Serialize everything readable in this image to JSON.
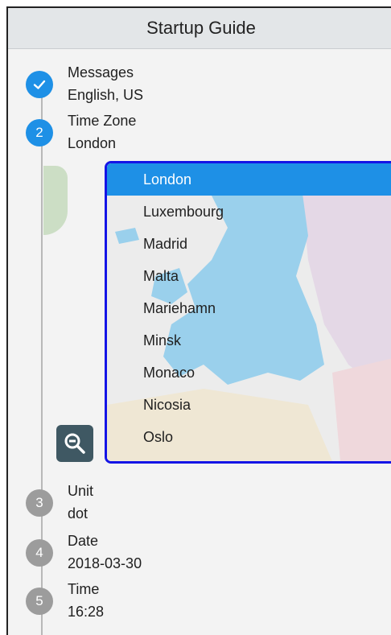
{
  "header": {
    "title": "Startup Guide"
  },
  "steps": [
    {
      "number": "✓",
      "title": "Messages",
      "value": "English, US",
      "state": "done"
    },
    {
      "number": "2",
      "title": "Time Zone",
      "value": "London",
      "state": "active"
    },
    {
      "number": "3",
      "title": "Unit",
      "value": "dot",
      "state": "inactive"
    },
    {
      "number": "4",
      "title": "Date",
      "value": "2018-03-30",
      "state": "inactive"
    },
    {
      "number": "5",
      "title": "Time",
      "value": "16:28",
      "state": "inactive"
    }
  ],
  "timezone_list": {
    "selected": "London",
    "items": [
      "London",
      "Luxembourg",
      "Madrid",
      "Malta",
      "Mariehamn",
      "Minsk",
      "Monaco",
      "Nicosia",
      "Oslo"
    ]
  },
  "icons": {
    "zoom": "zoom-out-icon",
    "check": "check-icon"
  },
  "colors": {
    "accent": "#1e90e6",
    "panel_border": "#1414e6",
    "zoom_button": "#3f5863"
  }
}
